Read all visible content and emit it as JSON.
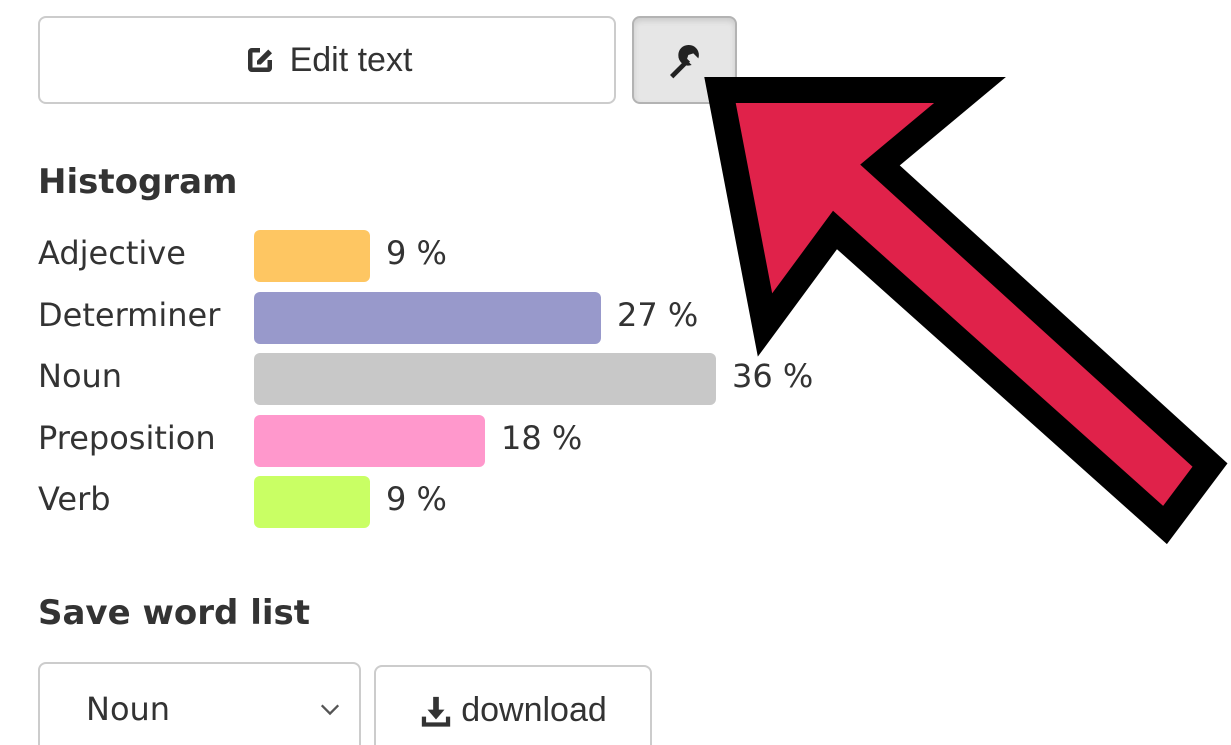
{
  "toolbar": {
    "edit_label": "Edit text",
    "edit_icon": "edit-icon",
    "settings_icon": "wrench-icon"
  },
  "histogram": {
    "title": "Histogram",
    "rows": [
      {
        "label": "Adjective",
        "value": 9,
        "value_text": "9 %",
        "color": "#fec662"
      },
      {
        "label": "Determiner",
        "value": 27,
        "value_text": "27 %",
        "color": "#9899cb"
      },
      {
        "label": "Noun",
        "value": 36,
        "value_text": "36 %",
        "color": "#c8c8c8"
      },
      {
        "label": "Preposition",
        "value": 18,
        "value_text": "18 %",
        "color": "#ff98cc"
      },
      {
        "label": "Verb",
        "value": 9,
        "value_text": "9 %",
        "color": "#c9ff64"
      }
    ]
  },
  "save": {
    "title": "Save word list",
    "select_value": "Noun",
    "download_label": "download",
    "download_icon": "download-icon"
  },
  "annotation": {
    "arrow_fill": "#e0224a",
    "arrow_outline": "#000000"
  }
}
